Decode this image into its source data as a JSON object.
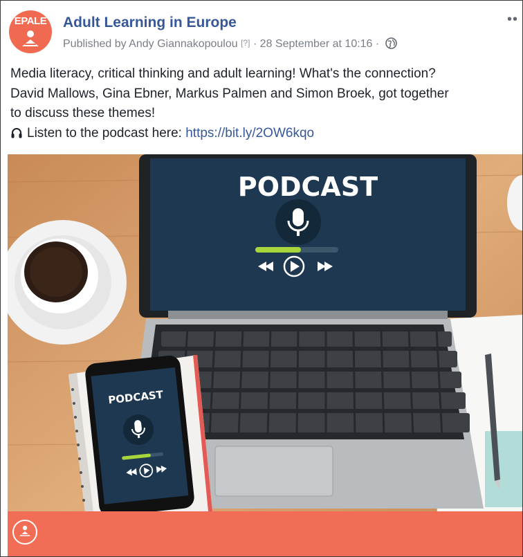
{
  "post": {
    "page_name": "Adult Learning in Europe",
    "avatar_brand": "EPALE",
    "published_by": "Published by Andy Giannakopoulou",
    "help_marker": "[?]",
    "separator": "·",
    "timestamp": "28 September at 10:16",
    "privacy_icon": "globe-icon",
    "more_icon": "ellipsis-icon",
    "text_line1": "Media literacy, critical thinking and adult learning! What's the connection?",
    "text_line2": "David Mallows, Gina Ebner, Markus Palmen and Simon Broek, got together",
    "text_line3": "to discuss these themes!",
    "listen_prefix": "Listen to the podcast here: ",
    "listen_icon": "headphones-icon",
    "link": "https://bit.ly/2OW6kqo"
  },
  "image": {
    "laptop_screen_title": "PODCAST",
    "phone_screen_title": "PODCAST",
    "laptop_progress": 0.55,
    "phone_progress": 0.7
  },
  "colors": {
    "brand": "#f06a52",
    "link": "#365899",
    "banner": "#f26d55"
  }
}
